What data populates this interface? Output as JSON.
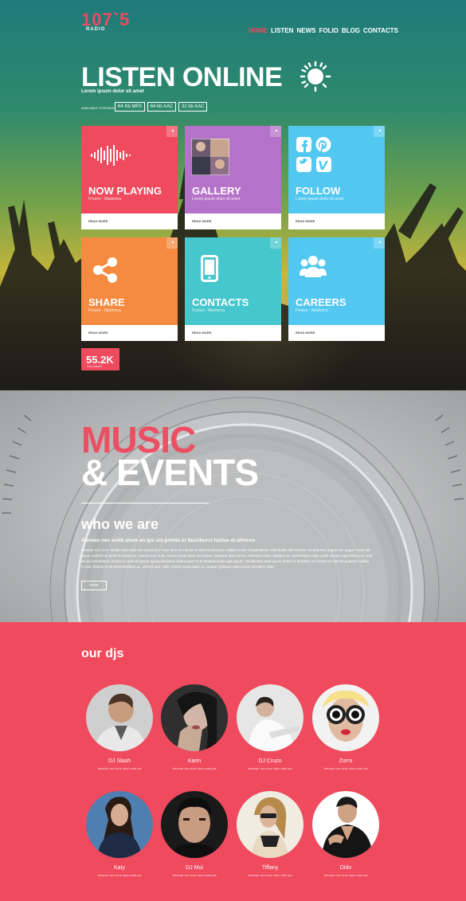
{
  "header": {
    "logo": "107`5",
    "logo_sub": "RADIO",
    "nav": [
      "HOME",
      "LISTEN",
      "NEWS",
      "FOLIO",
      "BLOG",
      "CONTACTS"
    ]
  },
  "hero": {
    "title": "LISTEN ONLINE",
    "subtitle": "Lorem ipsum dolor sit amet",
    "streams_label": "AVAILABLE STREAMS",
    "streams": [
      "64 Kb MP3",
      "64 kb AAC",
      "32 kb AAC"
    ]
  },
  "tiles": [
    {
      "title": "NOW PLAYING",
      "sub": "Frozen - Madonna",
      "link": "READ MORE",
      "icon": "sound-wave-icon",
      "color": "#ef4a5d"
    },
    {
      "title": "GALLERY",
      "sub": "Lorem ipsum dolor sit amet",
      "link": "READ MORE",
      "icon": "photo-icon",
      "color": "#b572c9"
    },
    {
      "title": "FOLLOW",
      "sub": "Lorem ipsum dolor sit amet",
      "link": "READ MORE",
      "icon": "social-icons",
      "color": "#52c8f0"
    },
    {
      "title": "SHARE",
      "sub": "Frozen - Madonna",
      "link": "READ MORE",
      "icon": "share-icon",
      "color": "#f58b41"
    },
    {
      "title": "CONTACTS",
      "sub": "Frozen - Madonna",
      "link": "READ MORE",
      "icon": "phone-icon",
      "color": "#46c7cd"
    },
    {
      "title": "CAREERS",
      "sub": "Frozen - Madonna",
      "link": "READ MORE",
      "icon": "people-icon",
      "color": "#52c8f0"
    }
  ],
  "counter": {
    "value": "55.2K",
    "label": "FOLLOWERS"
  },
  "events": {
    "title_red": "MUSIC",
    "title_white": "& EVENTS",
    "heading": "who we are",
    "lead": "Aenean nec estib ulum an ips um primis in fauciburci luctus et ultricos",
    "body": "Aenean nec eros. Vestib ulum ante ips us primis in fauc ibus orci luctus et ultrices posuere cubilia Curae; Suspendisse sollicitudin velit sed leo. Ut pharetra augue nec augue. Nam elit agna, endrerit sit amet tincidunt ac, viverra sed, nulla. Donec porta diam eu massa. Quisque diam lorem, interdum vitae, dapibus ac, scelerisque vitae, pede. Donec eget tellus non erat lacinia fermentum. Donec in velit vel ipsum auctovinbvarius ullamcorper et at NeMaecenas eget ipsum. Vestibulum ante ipsum primis in faucibus orci luctus et ultrices posuere cubilia Curae; Mauris et sit amet tincidunt ac, viverra sed, nulla. Donec porta diam eu massa. Quisque diam lorem interdum vitae.",
    "more": "more"
  },
  "djs": {
    "title": "our djs",
    "items": [
      {
        "name": "DJ Slash",
        "desc": "Aenean nec eros ulum ante ips"
      },
      {
        "name": "Karin",
        "desc": "Aenean nec eros ulum ante ips"
      },
      {
        "name": "DJ Cruzo",
        "desc": "Aenean nec eros ulum ante ips"
      },
      {
        "name": "Zorro",
        "desc": "Aenean nec eros ulum ante ips"
      },
      {
        "name": "Katy",
        "desc": "Aenean nec eros ulum ante ips"
      },
      {
        "name": "DJ Mui",
        "desc": "Aenean nec eros ulum ante ips"
      },
      {
        "name": "Tiffany",
        "desc": "Aenean nec eros ulum ante ips"
      },
      {
        "name": "Dido",
        "desc": "Aenean nec eros ulum ante ips"
      }
    ]
  }
}
